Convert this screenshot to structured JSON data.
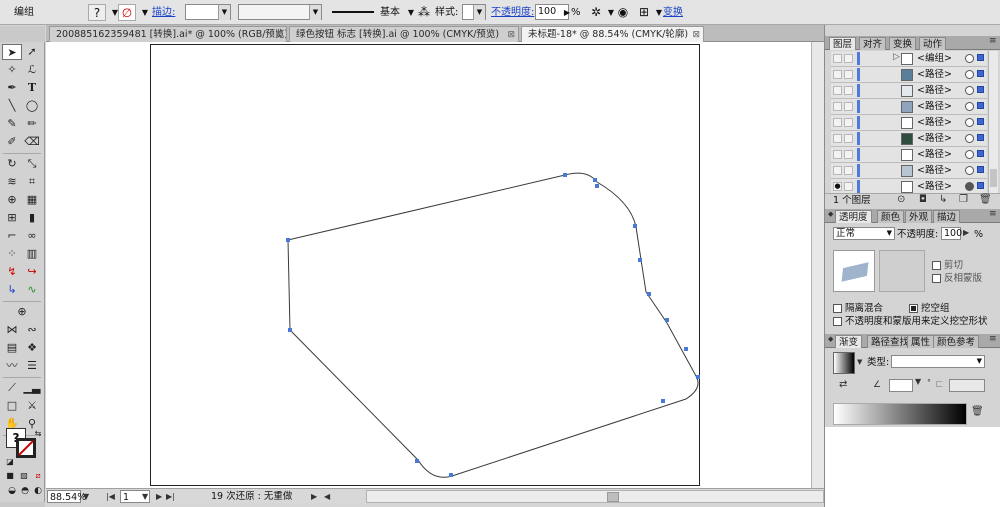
{
  "control_bar": {
    "selection_label": "编组",
    "stroke_label": "描边:",
    "brush_value": "基本",
    "style_label": "样式:",
    "opacity_label": "不透明度:",
    "opacity_value": "100",
    "opacity_unit": "%",
    "transform_label": "变换"
  },
  "doc_tabs": [
    {
      "label": "200885162359481 [转换].ai* @ 100% (RGB/预览)"
    },
    {
      "label": "绿色按钮 标志 [转换].ai @ 100% (CMYK/预览)"
    },
    {
      "label": "未标题-18* @ 88.54% (CMYK/轮廓)"
    }
  ],
  "status_bar": {
    "zoom": "88.54%",
    "page": "1",
    "undo_text": "19 次还原 : 无重做"
  },
  "layers_panel": {
    "tabs": [
      "图层",
      "对齐",
      "变换",
      "动作"
    ],
    "rows": [
      {
        "name": "<编组>"
      },
      {
        "name": "<路径>"
      },
      {
        "name": "<路径>"
      },
      {
        "name": "<路径>"
      },
      {
        "name": "<路径>"
      },
      {
        "name": "<路径>"
      },
      {
        "name": "<路径>"
      },
      {
        "name": "<路径>"
      },
      {
        "name": "<路径>"
      }
    ],
    "count_label": "1 个图层"
  },
  "transparency_panel": {
    "tabs": [
      "透明度",
      "颜色",
      "外观",
      "描边"
    ],
    "blend_mode": "正常",
    "opacity_label": "不透明度:",
    "opacity_value": "100",
    "opacity_unit": "%",
    "clip_label": "剪切",
    "invert_mask_label": "反相蒙版",
    "isolate_label": "隔离混合",
    "knockout_label": "挖空组",
    "define_knockout_label": "不透明度和蒙版用来定义挖空形状"
  },
  "gradient_panel": {
    "tabs": [
      "渐变",
      "路径查找",
      "属性",
      "颜色参考"
    ],
    "type_label": "类型:"
  },
  "icons": {
    "help": "question-icon",
    "selection": "arrow-icon",
    "artboard_eye": "eye-icon"
  },
  "colors": {
    "path_stroke": "#3a3a3a",
    "anchor": "#4a78d6",
    "selection_blue": "#3d65d4"
  }
}
